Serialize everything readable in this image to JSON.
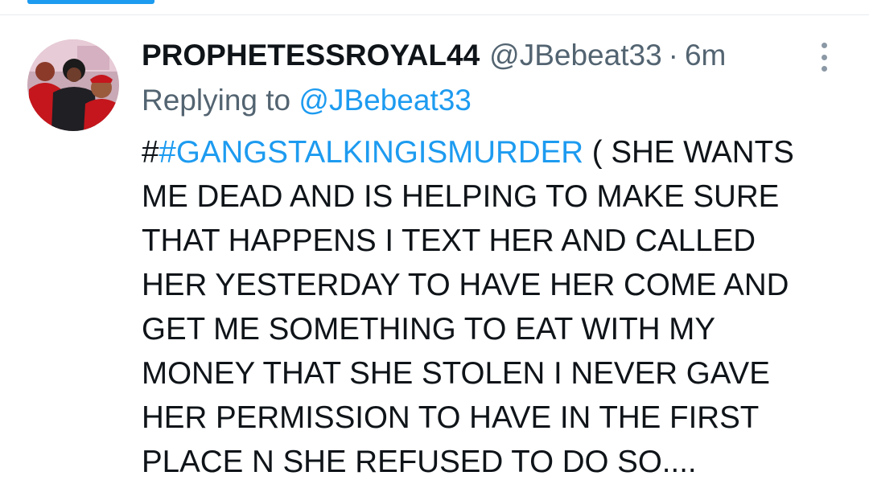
{
  "tweet": {
    "display_name": "PROPHETESSROYAL44",
    "handle": "@JBebeat33",
    "separator": "·",
    "time": "6m",
    "replying_prefix": "Replying to ",
    "replying_to": "@JBebeat33",
    "body_prefix": "#",
    "hashtag": "#GANGSTALKINGISMURDER",
    "body_lines": [
      " ( SHE WANTS",
      "ME DEAD AND IS HELPING TO MAKE SURE",
      "THAT HAPPENS I TEXT HER AND CALLED",
      "HER YESTERDAY TO HAVE HER COME AND",
      "GET ME SOMETHING TO EAT WITH MY",
      "MONEY THAT SHE STOLEN I NEVER GAVE",
      "HER PERMISSION TO HAVE IN THE FIRST",
      "PLACE N SHE REFUSED TO DO SO...."
    ]
  },
  "icons": {
    "more": "more-vertical-icon",
    "avatar": "profile-photo"
  },
  "colors": {
    "accent": "#1d9bf0",
    "text": "#0f1419",
    "muted": "#536471"
  }
}
